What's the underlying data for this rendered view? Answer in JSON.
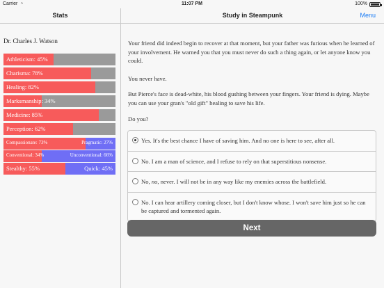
{
  "status_bar": {
    "carrier": "Carrier",
    "wifi_icon": "wifi-icon",
    "time": "11:07 PM",
    "battery_pct": "100%",
    "battery_icon": "battery-icon"
  },
  "sidebar": {
    "title": "Stats",
    "character_name": "Dr. Charles J. Watson",
    "stats": [
      {
        "label": "Athleticism: 45%",
        "value": 45
      },
      {
        "label": "Charisma: 78%",
        "value": 78
      },
      {
        "label": "Healing: 82%",
        "value": 82
      },
      {
        "label": "Marksmanship: 34%",
        "value": 34
      },
      {
        "label": "Medicine: 85%",
        "value": 85
      },
      {
        "label": "Perception: 62%",
        "value": 62
      }
    ],
    "opposed": [
      {
        "left": "Compassionate: 73%",
        "right": "Pragmatic: 27%",
        "value": 73
      },
      {
        "left": "Conventional: 34%",
        "right": "Unconventional: 66%",
        "value": 34
      },
      {
        "left": "Stealthy: 55%",
        "right": "Quick: 45%",
        "value": 55
      }
    ]
  },
  "main": {
    "title": "Study in Steampunk",
    "menu_label": "Menu",
    "paragraphs": [
      "Your friend did indeed begin to recover at that moment, but your father was furious when he learned of your involvement. He warned you that you must never do such a thing again, or let anyone know you could.",
      "You never have.",
      "But Pierce's face is dead-white, his blood gushing between your fingers. Your friend is dying. Maybe you can use your gran's \"old gift\" healing to save his life.",
      "Do you?"
    ],
    "choices": [
      {
        "text": "Yes. It's the best chance I have of saving him. And no one is here to see, after all.",
        "selected": true
      },
      {
        "text": "No. I am a man of science, and I refuse to rely on that superstitious nonsense.",
        "selected": false
      },
      {
        "text_a": "No, ",
        "text_b": "no",
        "text_c": ", never. I will not be in any way like my enemies across the battlefield.",
        "selected": false
      },
      {
        "text": "No. I can hear artillery coming closer, but I don't know whose. I won't save him just so he can be captured and tormented again.",
        "selected": false
      }
    ],
    "next_label": "Next"
  },
  "colors": {
    "stat_fill": "#f75b5b",
    "stat_bg": "#9a9a9a",
    "opposed_bg": "#6f6ef5",
    "accent": "#1a7cf5",
    "next_button": "#666666"
  }
}
